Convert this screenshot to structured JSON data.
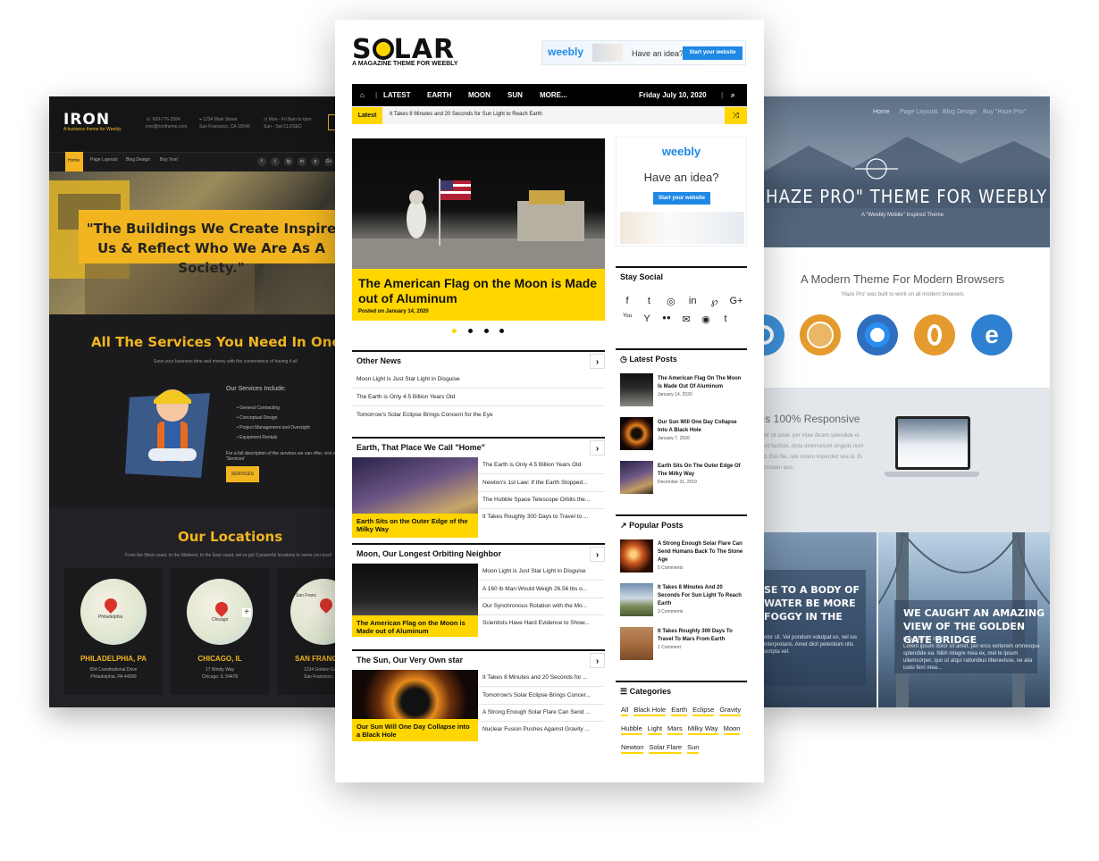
{
  "iron": {
    "logo": "IRON",
    "tagline": "A business theme for Weebly",
    "contact": {
      "phone": "609-776-2564",
      "email": "iron@irontheme.com",
      "address1": "1234 Main Street",
      "address2": "San Francisco, CA 15546",
      "hours1": "Mon - Fri 8am to 6pm",
      "hours2": "Sun - Sat CLOSED"
    },
    "nav": [
      "Home",
      "Page Layouts",
      "Blog Design",
      "Buy 'Iron'"
    ],
    "social": [
      "f",
      "t",
      "ig",
      "in",
      "p",
      "G+"
    ],
    "hero_quote": "\"The Buildings We Create Inspire Us & Reflect Who We Are As A Society.\"",
    "services_title": "All The Services You Need In One Locati",
    "services_sub": "Save your business time and money with the convenience of having it all",
    "services_include": "Our Services Include:",
    "services_list": [
      "General Contracting",
      "Conceptual Design",
      "Project Management and Oversight",
      "Equipment Rentals"
    ],
    "services_desc": "For a full description of the services we can offer, visit our 'Services'",
    "services_button": "SERVICES",
    "locations_title": "Our Locations",
    "locations_sub": "From the West coast, to the Midwest, to the East coast, we've got 3 powerful locations to serve you best!",
    "locations": [
      {
        "name": "PHILADELPHIA, PA",
        "addr1": "554 Constitutional Drive",
        "addr2": "Philadelphia, PA 44589",
        "map": "Philadelphia"
      },
      {
        "name": "CHICAGO, IL",
        "addr1": "17 Windy Way",
        "addr2": "Chicago, IL 54478",
        "map": "Chicago"
      },
      {
        "name": "SAN FRANCIS",
        "addr1": "1234 Golden Gat",
        "addr2": "San Francisco, CA",
        "map": "San Franc"
      }
    ]
  },
  "solar": {
    "logo_a": "S",
    "logo_b": "LAR",
    "tagline": "A MAGAZINE THEME FOR WEEBLY",
    "ad": {
      "brand": "weebly",
      "text": "Have an idea?",
      "cta": "Start your website"
    },
    "nav": [
      "LATEST",
      "EARTH",
      "MOON",
      "SUN",
      "MORE..."
    ],
    "date": "Friday July 10, 2020",
    "latest_label": "Latest",
    "latest_text": "It Takes 8 Minutes and 20 Seconds for Sun Light to Reach Earth",
    "slide": {
      "title": "The American Flag on the Moon is Made out of Aluminum",
      "date": "Posted on January 14, 2020"
    },
    "other_news": {
      "title": "Other News",
      "items": [
        "Moon Light is Just Star Light in Disguise",
        "The Earth is Only 4.5 Billion Years Old",
        "Tomorrow's Solar Eclipse Brings Concern for the Eye"
      ]
    },
    "earth": {
      "title": "Earth, That Place We Call \"Home\"",
      "feature": "Earth Sits on the Outer Edge of the Milky Way",
      "items": [
        "The Earth is Only 4.5 Billion Years Old",
        "Newton's 1st Law: If the Earth Stopped...",
        "The Hubble Space Telescope Orbits the...",
        "It Takes Roughly 300 Days to Travel to ..."
      ]
    },
    "moon": {
      "title": "Moon, Our Longest Orbiting Neighbor",
      "feature": "The American Flag on the Moon is Made out of Aluminum",
      "items": [
        "Moon Light is Just Star Light in Disguise",
        "A 160 lb Man Would Weigh 26.56 lbs o...",
        "Our Synchronous Rotation with the Mo...",
        "Scientists Have Hard Evidence to Show..."
      ]
    },
    "sunsec": {
      "title": "The Sun, Our Very Own star",
      "feature": "Our Sun Will One Day Collapse into a Black Hole",
      "items": [
        "It Takes 8 Minutes and 20 Seconds for ...",
        "Tomorrow's Solar Eclipse Brings Concer...",
        "A Strong Enough Solar Flare Can Send ...",
        "Nuclear Fusion Pushes Against Gravity ..."
      ]
    },
    "side_ad": {
      "brand": "weebly",
      "text": "Have an idea?",
      "cta": "Start your website"
    },
    "stay_social": "Stay Social",
    "social_icons": [
      "f",
      "t",
      "◎",
      "in",
      "℘",
      "G+",
      "You",
      "Y",
      "●●",
      "✉",
      "◉",
      "t"
    ],
    "latest_posts": {
      "title": "Latest Posts",
      "items": [
        {
          "title": "The American Flag On The Moon Is Made Out Of Aluminum",
          "meta": "January 14, 2020"
        },
        {
          "title": "Our Sun Will One Day Collapse Into A Black Hole",
          "meta": "January 7, 2020"
        },
        {
          "title": "Earth Sits On The Outer Edge Of The Milky Way",
          "meta": "December 31, 2019"
        }
      ]
    },
    "popular_posts": {
      "title": "Popular Posts",
      "items": [
        {
          "title": "A Strong Enough Solar Flare Can Send Humans Back To The Stone Age",
          "meta": "5 Comments"
        },
        {
          "title": "It Takes 8 Minutes And 20 Seconds For Sun Light To Reach Earth",
          "meta": "3 Comments"
        },
        {
          "title": "It Takes Roughly 300 Days To Travel To Mars From Earth",
          "meta": "1 Comment"
        }
      ]
    },
    "categories": {
      "title": "Categories",
      "items": [
        "All",
        "Black Hole",
        "Earth",
        "Eclipse",
        "Gravity",
        "Hubble",
        "Light",
        "Mars",
        "Milky Way",
        "Moon",
        "Newton",
        "Solar Flare",
        "Sun"
      ]
    }
  },
  "haze": {
    "nav": [
      "Home",
      "Page Layouts",
      "Blog Design",
      "Buy \"Haze Pro\""
    ],
    "title": "\"HAZE PRO\" THEME FOR WEEBLY",
    "subtitle": "A \"Weebly Mobile\" Inspired Theme",
    "modern_title": "A Modern Theme For Modern Browsers",
    "modern_sub": "'Haze Pro' was built to work on all modern browsers",
    "responsive_title": "Is 100% Responsive",
    "responsive_text": "olor sit amet, per vitae dicam splendide ei. rent facilisis, dicta deterruisset singulis num ad. Eos Ne, tale cetero imperdiet sea id. Ei accusam quo.",
    "photo1_title": "SE TO A BODY OF WATER BE MORE FOGGY IN THE",
    "photo1_text": "olor sit. Vel pondum volutpat ex, nel ius interpretaris. Amet dicit petentium ntis scripta vel.",
    "photo2_title": "WE CAUGHT AN AMAZING VIEW OF THE GOLDEN GATE BRIDGE",
    "photo2_date": "December 26, 2019",
    "photo2_text": "Lorem ipsum dolor sit amet, per eros verterem omnesque splendide ea. Nibh integre mea ex, mel te ipsum ullamcorper, quo ut atqui rationibus liberavisse, ne alia iusto ferri mea..."
  },
  "colors": {
    "yellow": "#ffd600",
    "iron_gold": "#f2b51f",
    "weebly_blue": "#1e88e5"
  }
}
